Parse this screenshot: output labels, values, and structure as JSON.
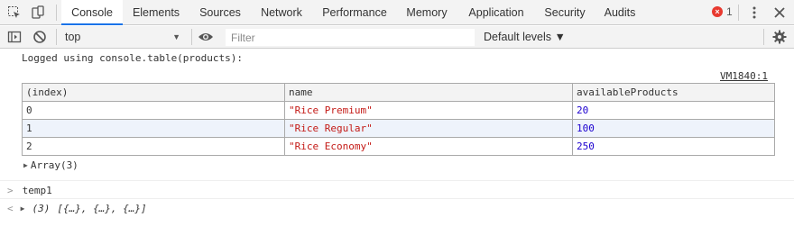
{
  "tabs": [
    {
      "label": "Console",
      "active": true
    },
    {
      "label": "Elements",
      "active": false
    },
    {
      "label": "Sources",
      "active": false
    },
    {
      "label": "Network",
      "active": false
    },
    {
      "label": "Performance",
      "active": false
    },
    {
      "label": "Memory",
      "active": false
    },
    {
      "label": "Application",
      "active": false
    },
    {
      "label": "Security",
      "active": false
    },
    {
      "label": "Audits",
      "active": false
    }
  ],
  "error_count": "1",
  "toolbar": {
    "context": "top",
    "filter_placeholder": "Filter",
    "levels": "Default levels ▼"
  },
  "log": {
    "message": "Logged using console.table(products):",
    "source": "VM1840:1"
  },
  "table": {
    "headers": [
      "(index)",
      "name",
      "availableProducts"
    ],
    "rows": [
      [
        "0",
        "\"Rice Premium\"",
        "20"
      ],
      [
        "1",
        "\"Rice Regular\"",
        "100"
      ],
      [
        "2",
        "\"Rice Economy\"",
        "250"
      ]
    ]
  },
  "array_label": "Array(3)",
  "input_expression": "temp1",
  "result": {
    "count": "(3)",
    "items": "[{…}, {…}, {…}]"
  },
  "colors": {
    "accent": "#1a73e8",
    "string": "#c41a16",
    "number": "#1c00cf",
    "error": "#e8392f"
  }
}
